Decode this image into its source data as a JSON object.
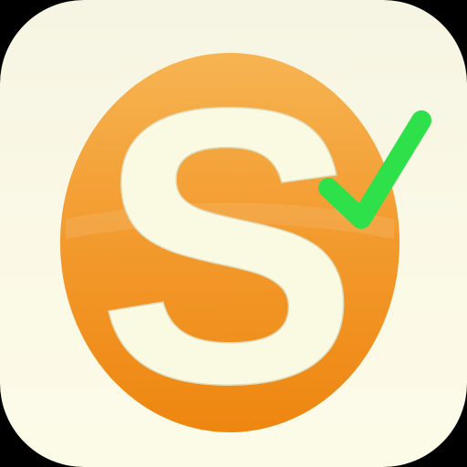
{
  "app_icon": {
    "letter": "S",
    "badge_icon": "checkmark-icon",
    "colors": {
      "background": "#f8f6e4",
      "ring_top": "#f5b14e",
      "ring_bottom": "#f08a12",
      "letter": "#fafae2",
      "check": "#2ee04a",
      "frame": "#000000"
    }
  }
}
